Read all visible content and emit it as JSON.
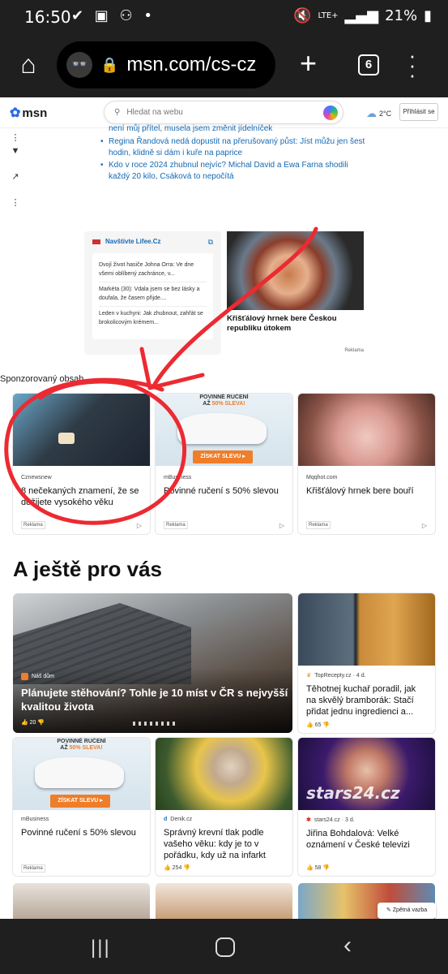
{
  "status": {
    "time": "16:50",
    "left_icons": "✔ ▣ ⚇ •",
    "lte": "LTE+",
    "battery": "21%"
  },
  "browser": {
    "url": "msn.com/cs-cz",
    "tab_count": "6"
  },
  "header": {
    "logo_text": "msn",
    "search_placeholder": "Hledat na webu",
    "temperature": "2°C",
    "signin_label": "Přihlásit se"
  },
  "news_links": [
    "není můj přítel, musela jsem změnit jídelníček",
    "Regina Řandová nedá dopustit na přerušovaný půst: Jíst můžu jen šest hodin, klidně si dám i kuře na paprice",
    "Kdo v roce 2024 zhubnul nejvíc? Michal David a Ewa Farna shodili každý 20 kilo, Csáková to nepočítá"
  ],
  "lifee": {
    "header": "Navštivte Lifee.Cz",
    "items": [
      "Dvojí život hasiče Johna Orra: Ve dne všemi oblíbený zachránce, v...",
      "Markéta (30): Vdala jsem se bez lásky a doufala, že časem přijde....",
      "Leden v kuchyni: Jak zhubnout, zahřát se brokolicovým krémem..."
    ]
  },
  "mug_ad": {
    "title": "Křišťálový hrnek bere Českou republiku útokem",
    "reklama": "Reklama"
  },
  "sponsored_label": "Sponzorovaný obsah",
  "sponsored_cards": [
    {
      "source": "Cznewsnew",
      "title": "8 nečekaných znamení, že se dožijete vysokého věku",
      "tag": "Reklama"
    },
    {
      "source": "mBusiness",
      "title": "Povinné ručení s 50% slevou",
      "tag": "Reklama"
    },
    {
      "source": "Mqqhot.com",
      "title": "Křišťálový hrnek bere bouří",
      "tag": "Reklama"
    }
  ],
  "car_ad": {
    "line1": "POVINNÉ RUČENÍ",
    "line2_prefix": "AŽ ",
    "line2_highlight": "50% SLEVA!",
    "button": "ZÍSKAT SLEVU ▸"
  },
  "section_title": "A ještě pro vás",
  "feed": {
    "big": {
      "source": "Náš dům",
      "title": "Plánujete stěhování? Tohle je 10 míst v ČR s nejvyšší kvalitou života",
      "likes": "👍 20  👎"
    },
    "card1": {
      "source": "TopRecepty.cz · 4 d.",
      "title": "Těhotnej kuchař poradil, jak na skvělý bramborák: Stačí přidat jednu ingredienci a...",
      "likes": "👍 65  👎"
    },
    "card2": {
      "source": "mBusiness",
      "title": "Povinné ručení s 50% slevou",
      "tag": "Reklama"
    },
    "card3": {
      "source": "Denik.cz",
      "title": "Správný krevní tlak podle vašeho věku: kdy je to v pořádku, kdy už na infarkt",
      "likes": "👍 254  👎"
    },
    "card4": {
      "source": "stars24.cz · 3 d.",
      "title": "Jiřina Bohdalová: Velké oznámení v České televizi",
      "likes": "👍 58  👎",
      "watermark": "stars24.cz"
    }
  },
  "feedback_label": "Zpětná vazba",
  "colors": {
    "link_blue": "#1469b3",
    "annotation_red": "#ec2a32",
    "accent_orange": "#f07d28"
  }
}
